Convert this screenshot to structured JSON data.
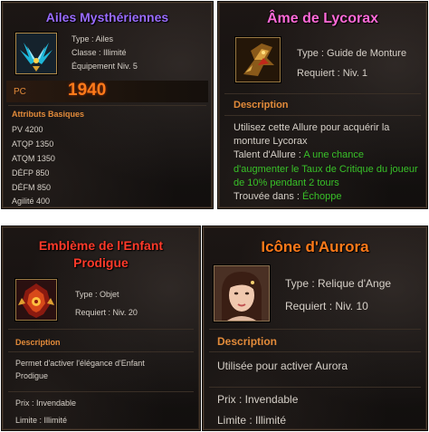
{
  "colors": {
    "title_purple": "#9a6cff",
    "title_pink": "#ff6ad8",
    "title_red": "#ff3a2a",
    "title_orange": "#ff7a1a",
    "section_orange": "#e38b3a",
    "text": "#d6d0c8",
    "highlight_green": "#38c028"
  },
  "wings": {
    "title": "Ailes Mysthériennes",
    "icon": "wings-icon",
    "type": "Type : Ailes",
    "classe": "Classe : Illimité",
    "equipement": "Équipement Niv. 5",
    "pc_label": "PC",
    "pc_value": "1940",
    "attributes_title": "Attributs Basiques",
    "attributes": [
      "PV 4200",
      "ATQP 1350",
      "ATQM 1350",
      "DÉFP 850",
      "DÉFM 850",
      "Agilité 400"
    ]
  },
  "lycorax": {
    "title": "Âme de Lycorax",
    "icon": "mount-soul-icon",
    "type": "Type : Guide de Monture",
    "requiert": "Requiert : Niv. 1",
    "description_title": "Description",
    "description_line1": "Utilisez cette Allure pour acquérir la",
    "description_line2": "monture Lycorax",
    "talent_label": "Talent d'Allure : ",
    "talent_line1": "A une chance",
    "talent_line2": "d'augmenter le Taux de Critique du joueur",
    "talent_line3": "de 10% pendant 2 tours",
    "trouvee_label": "Trouvée dans : ",
    "trouvee_value": "Échoppe"
  },
  "emblem": {
    "title_line1": "Emblème de l'Enfant",
    "title_line2": "Prodigue",
    "icon": "emblem-icon",
    "type": "Type : Objet",
    "requiert": "Requiert : Niv. 20",
    "description_title": "Description",
    "description_line1": "Permet d'activer l'élégance d'Enfant",
    "description_line2": "Prodigue",
    "prix": "Prix : Invendable",
    "limite": "Limite : Illimité"
  },
  "aurora": {
    "title": "Icône d'Aurora",
    "icon": "portrait-icon",
    "type": "Type : Relique d'Ange",
    "requiert": "Requiert : Niv. 10",
    "description_title": "Description",
    "description": "Utilisée pour activer Aurora",
    "prix": "Prix : Invendable",
    "limite": "Limite : Illimité"
  }
}
